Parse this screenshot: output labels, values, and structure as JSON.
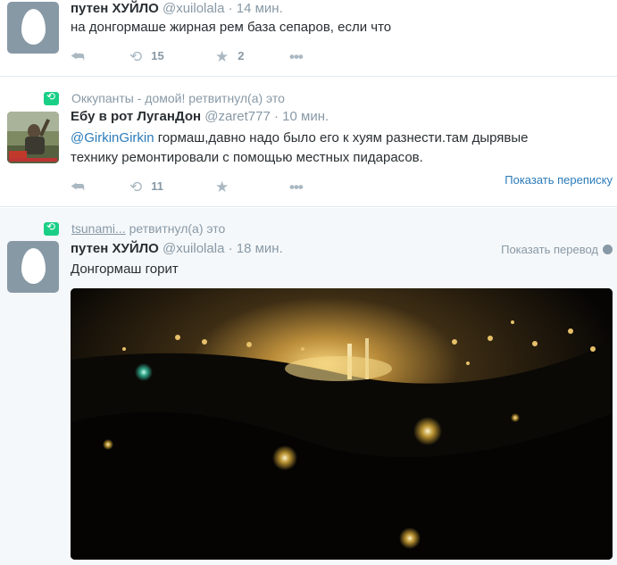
{
  "tweets": [
    {
      "fullname": "путен ХУЙЛО",
      "username": "@xuilolala",
      "time": "14 мин.",
      "text": "на донгормаше жирная рем база сепаров, если что",
      "retweets": "15",
      "favorites": "2",
      "reply_icon": "reply-icon",
      "retweet_icon": "retweet-icon",
      "fav_icon": "star-icon",
      "more_icon": "more-icon"
    },
    {
      "retweet_context": "Оккупанты - домой! ретвитнул(а) это",
      "fullname": "Ебу в рот ЛуганДон",
      "username": "@zaret777",
      "time": "10 мин.",
      "mention": "@GirkinGirkin",
      "text_line1": " гормаш,давно надо было его к хуям разнести.там дырявые",
      "text_line2": "технику ремонтировали с помощью местных пидарасов.",
      "retweets": "11",
      "conversation_link": "Показать переписку"
    },
    {
      "retweet_user": "tsunami...",
      "retweet_suffix": " ретвитнул(а) это",
      "fullname": "путен ХУЙЛО",
      "username": "@xuilolala",
      "time": "18 мин.",
      "text": "Донгормаш горит",
      "translate_link": "Показать перевод"
    }
  ],
  "separator": "·",
  "colors": {
    "link": "#2b7bb9",
    "muted": "#8899a6",
    "retweet_green": "#19cf86",
    "highlight_bg": "#f5f8fa"
  }
}
